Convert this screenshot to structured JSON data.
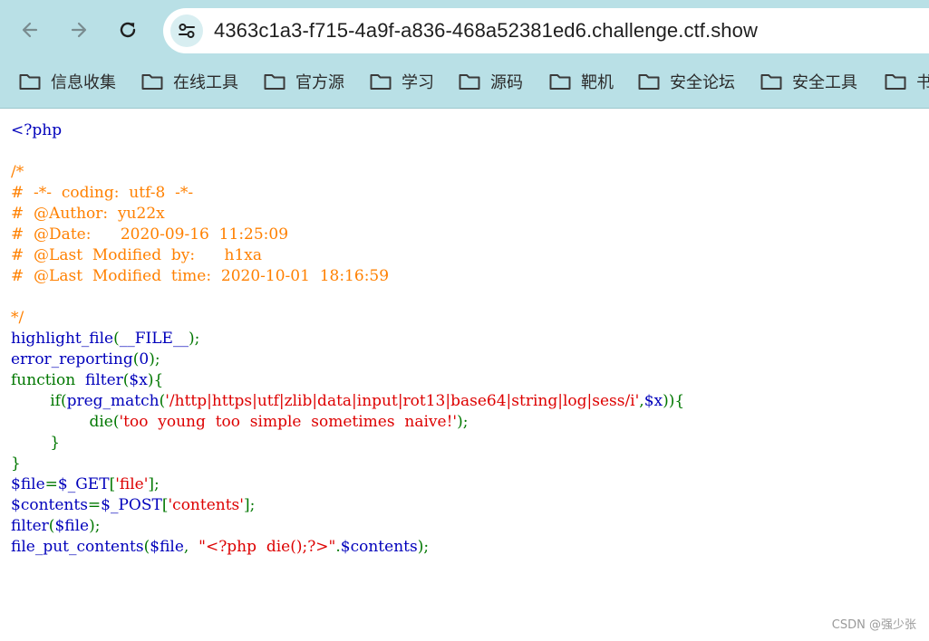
{
  "browser": {
    "url": "4363c1a3-f715-4a9f-a836-468a52381ed6.challenge.ctf.show",
    "back_icon": "arrow-left-icon",
    "forward_icon": "arrow-right-icon",
    "reload_icon": "reload-icon",
    "site_info_icon": "tune-icon"
  },
  "bookmarks": [
    {
      "label": "信息收集"
    },
    {
      "label": "在线工具"
    },
    {
      "label": "官方源"
    },
    {
      "label": "学习"
    },
    {
      "label": "源码"
    },
    {
      "label": "靶机"
    },
    {
      "label": "安全论坛"
    },
    {
      "label": "安全工具"
    },
    {
      "label": "书"
    }
  ],
  "code_lines": [
    [
      {
        "t": "<?php",
        "c": "default"
      }
    ],
    [],
    [
      {
        "t": "/*",
        "c": "comment"
      }
    ],
    [
      {
        "t": "#  -*-  coding:  utf-8  -*-",
        "c": "comment"
      }
    ],
    [
      {
        "t": "#  @Author:  yu22x",
        "c": "comment"
      }
    ],
    [
      {
        "t": "#  @Date:      2020-09-16  11:25:09",
        "c": "comment"
      }
    ],
    [
      {
        "t": "#  @Last  Modified  by:      h1xa",
        "c": "comment"
      }
    ],
    [
      {
        "t": "#  @Last  Modified  time:  2020-10-01  18:16:59",
        "c": "comment"
      }
    ],
    [],
    [
      {
        "t": "*/",
        "c": "comment"
      }
    ],
    [
      {
        "t": "highlight_file",
        "c": "default"
      },
      {
        "t": "(",
        "c": "keyword"
      },
      {
        "t": "__FILE__",
        "c": "default"
      },
      {
        "t": ");",
        "c": "keyword"
      }
    ],
    [
      {
        "t": "error_reporting",
        "c": "default"
      },
      {
        "t": "(",
        "c": "keyword"
      },
      {
        "t": "0",
        "c": "default"
      },
      {
        "t": ");",
        "c": "keyword"
      }
    ],
    [
      {
        "t": "function  ",
        "c": "keyword"
      },
      {
        "t": "filter",
        "c": "default"
      },
      {
        "t": "(",
        "c": "keyword"
      },
      {
        "t": "$x",
        "c": "default"
      },
      {
        "t": "){",
        "c": "keyword"
      }
    ],
    [
      {
        "t": "        if(",
        "c": "keyword"
      },
      {
        "t": "preg_match",
        "c": "default"
      },
      {
        "t": "(",
        "c": "keyword"
      },
      {
        "t": "'/http|https|utf|zlib|data|input|rot13|base64|string|log|sess/i'",
        "c": "string"
      },
      {
        "t": ",",
        "c": "keyword"
      },
      {
        "t": "$x",
        "c": "default"
      },
      {
        "t": ")){",
        "c": "keyword"
      }
    ],
    [
      {
        "t": "                die(",
        "c": "keyword"
      },
      {
        "t": "'too  young  too  simple  sometimes  naive!'",
        "c": "string"
      },
      {
        "t": ");",
        "c": "keyword"
      }
    ],
    [
      {
        "t": "        }",
        "c": "keyword"
      }
    ],
    [
      {
        "t": "}",
        "c": "keyword"
      }
    ],
    [
      {
        "t": "$file",
        "c": "default"
      },
      {
        "t": "=",
        "c": "keyword"
      },
      {
        "t": "$_GET",
        "c": "default"
      },
      {
        "t": "[",
        "c": "keyword"
      },
      {
        "t": "'file'",
        "c": "string"
      },
      {
        "t": "];",
        "c": "keyword"
      }
    ],
    [
      {
        "t": "$contents",
        "c": "default"
      },
      {
        "t": "=",
        "c": "keyword"
      },
      {
        "t": "$_POST",
        "c": "default"
      },
      {
        "t": "[",
        "c": "keyword"
      },
      {
        "t": "'contents'",
        "c": "string"
      },
      {
        "t": "];",
        "c": "keyword"
      }
    ],
    [
      {
        "t": "filter",
        "c": "default"
      },
      {
        "t": "(",
        "c": "keyword"
      },
      {
        "t": "$file",
        "c": "default"
      },
      {
        "t": ");",
        "c": "keyword"
      }
    ],
    [
      {
        "t": "file_put_contents",
        "c": "default"
      },
      {
        "t": "(",
        "c": "keyword"
      },
      {
        "t": "$file",
        "c": "default"
      },
      {
        "t": ",  ",
        "c": "keyword"
      },
      {
        "t": "\"<?php  die();?>\"",
        "c": "string"
      },
      {
        "t": ".",
        "c": "keyword"
      },
      {
        "t": "$contents",
        "c": "default"
      },
      {
        "t": ");",
        "c": "keyword"
      }
    ]
  ],
  "watermark": "CSDN @强少张"
}
